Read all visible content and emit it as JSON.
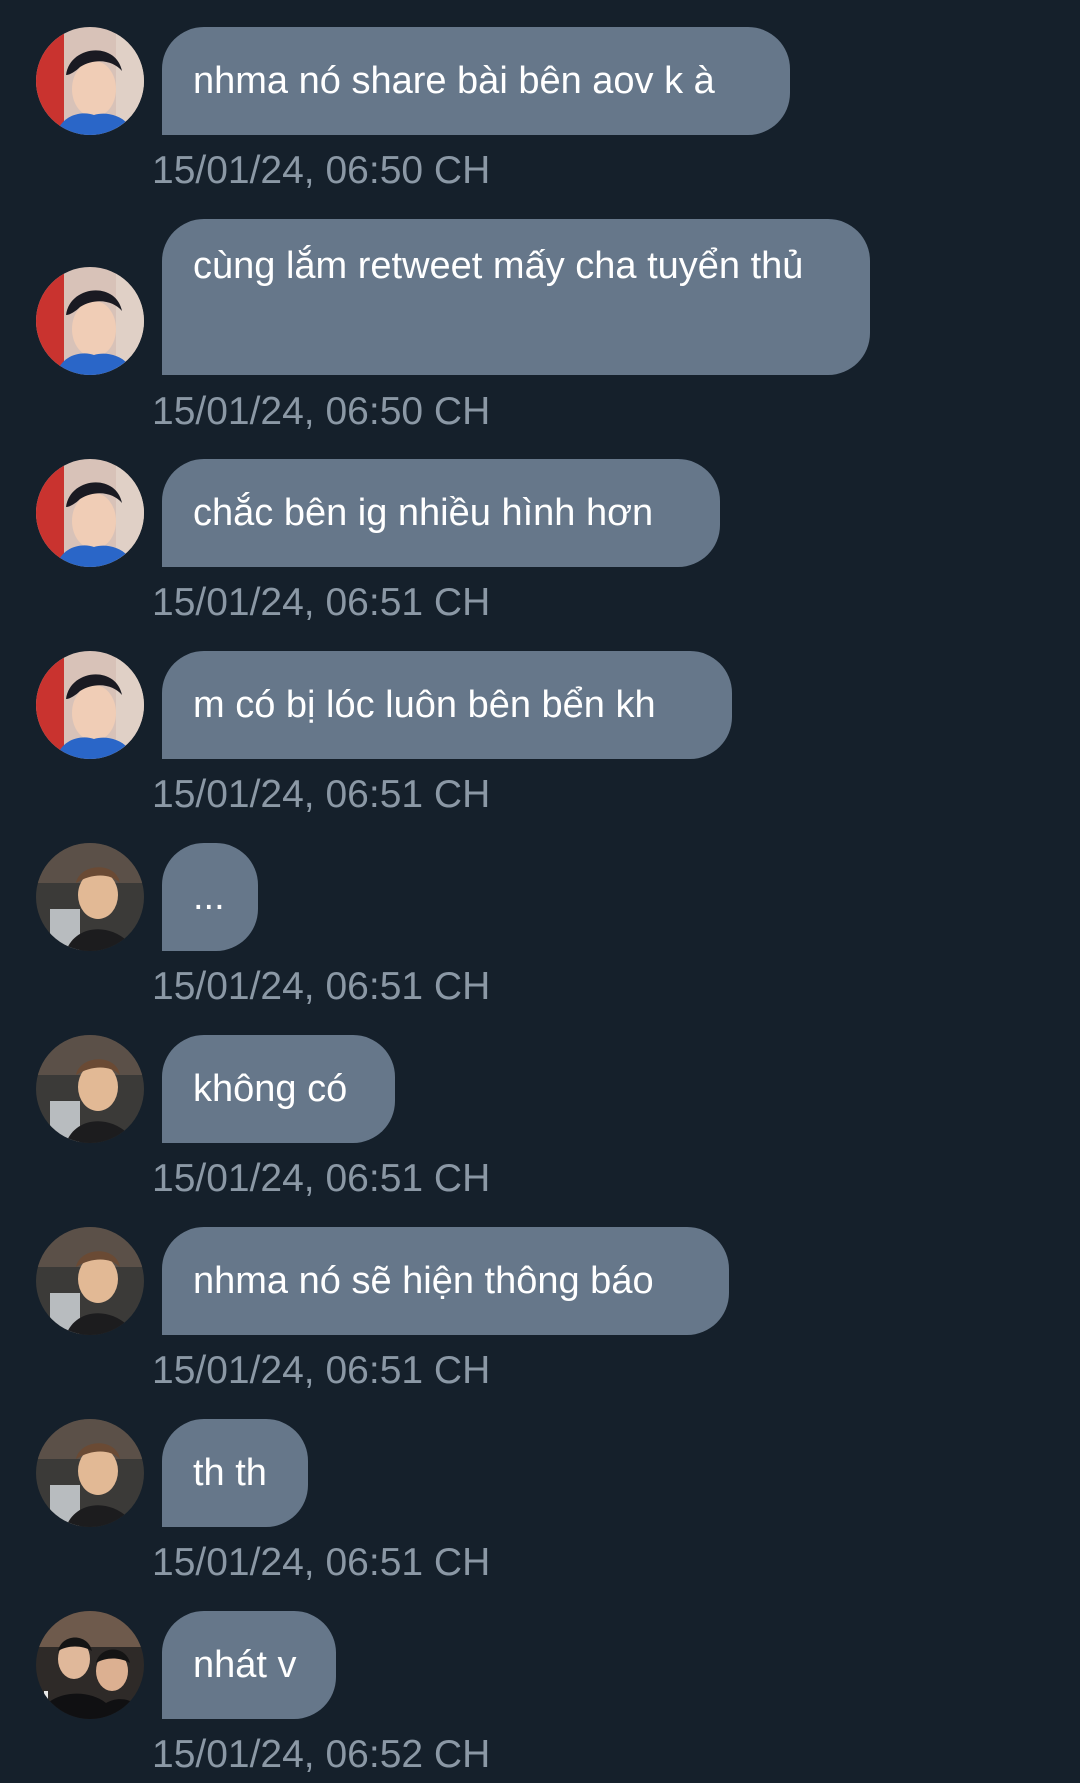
{
  "messages": [
    {
      "avatar": "avatar-a",
      "text": "nhma nó share bài bên aov k à",
      "time": "15/01/24, 06:50 CH"
    },
    {
      "avatar": "avatar-a",
      "text": "cùng lắm retweet mấy cha tuyển thủ",
      "time": "15/01/24, 06:50 CH"
    },
    {
      "avatar": "avatar-a",
      "text": "chắc bên ig nhiều hình hơn",
      "time": "15/01/24, 06:51 CH"
    },
    {
      "avatar": "avatar-a",
      "text": "m có bị lóc luôn bên bển kh",
      "time": "15/01/24, 06:51 CH"
    },
    {
      "avatar": "avatar-b",
      "text": "...",
      "time": "15/01/24, 06:51 CH"
    },
    {
      "avatar": "avatar-b",
      "text": "không có",
      "time": "15/01/24, 06:51 CH"
    },
    {
      "avatar": "avatar-b",
      "text": "nhma nó sẽ hiện thông báo",
      "time": "15/01/24, 06:51 CH"
    },
    {
      "avatar": "avatar-b",
      "text": "th th",
      "time": "15/01/24, 06:51 CH"
    },
    {
      "avatar": "avatar-c",
      "text": "nhát v",
      "time": "15/01/24, 06:52 CH"
    }
  ],
  "colors": {
    "background": "#15202b",
    "bubble": "#66778a",
    "message_text": "#ffffff",
    "timestamp_text": "#8b98a5"
  }
}
